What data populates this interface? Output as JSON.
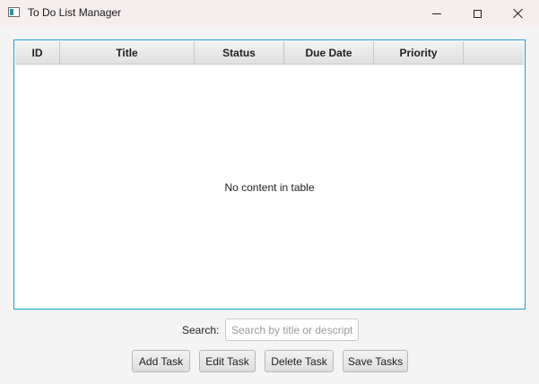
{
  "window": {
    "title": "To Do List Manager",
    "icon": "app-window-icon",
    "controls": [
      "minimize-icon",
      "maximize-icon",
      "close-icon"
    ]
  },
  "table": {
    "columns": [
      "ID",
      "Title",
      "Status",
      "Due Date",
      "Priority"
    ],
    "rows": [],
    "placeholder": "No content in table"
  },
  "search": {
    "label": "Search:",
    "placeholder": "Search by title or description",
    "value": ""
  },
  "actions": {
    "add": "Add Task",
    "edit": "Edit Task",
    "delete": "Delete Task",
    "save": "Save Tasks"
  },
  "colors": {
    "table_focus_border": "#1a9fd6",
    "titlebar_bg": "#f6eeee",
    "window_bg": "#f4f4f4"
  }
}
